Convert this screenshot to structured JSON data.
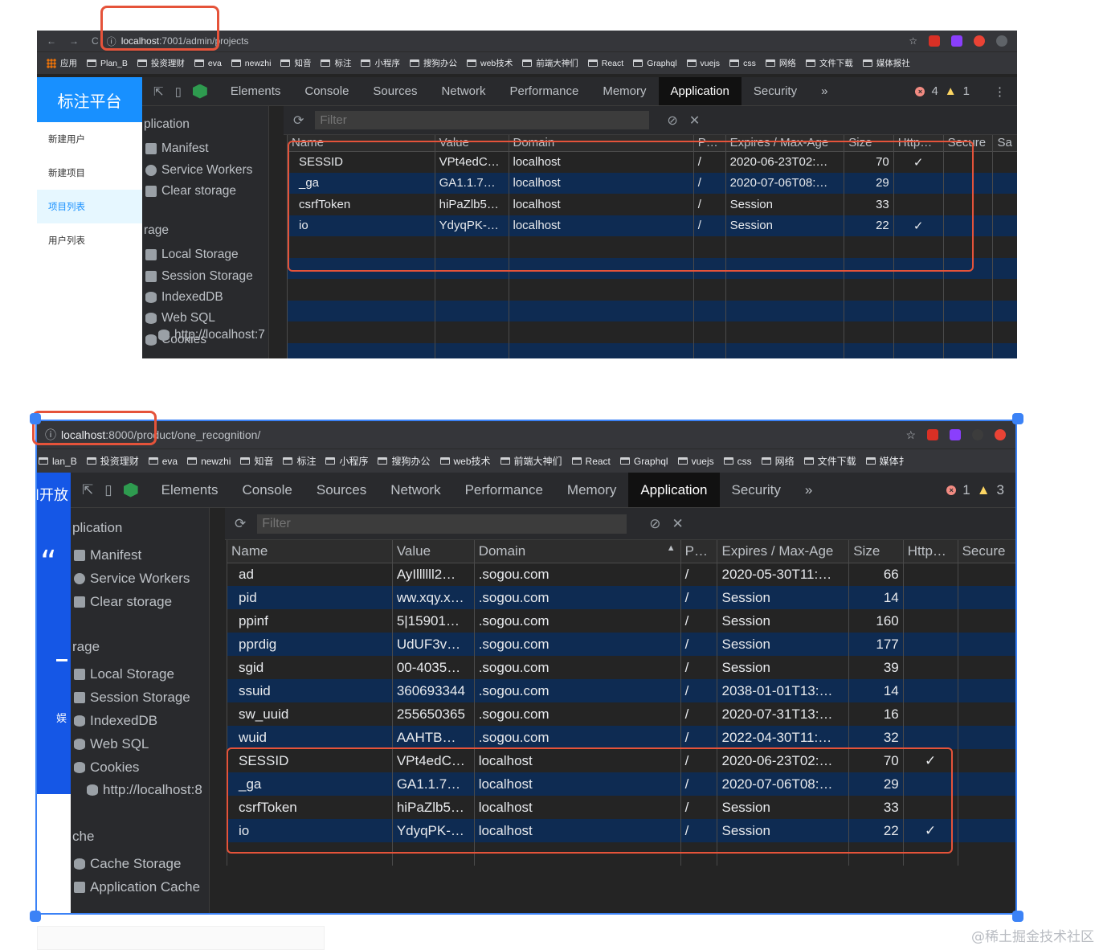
{
  "shot1": {
    "url_host": "localhost",
    "url_path": ":7001/admin/projects",
    "bookmarks": [
      "应用",
      "Plan_B",
      "投资理财",
      "eva",
      "newzhi",
      "知音",
      "标注",
      "小程序",
      "搜狗办公",
      "web技术",
      "前端大神们",
      "React",
      "Graphql",
      "vuejs",
      "css",
      "网络",
      "文件下载",
      "媒体报社"
    ],
    "app_title": "标注平台",
    "menu": [
      {
        "label": "新建用户",
        "active": false
      },
      {
        "label": "新建项目",
        "active": false
      },
      {
        "label": "项目列表",
        "active": true
      },
      {
        "label": "用户列表",
        "active": false
      }
    ],
    "tabs": [
      "Elements",
      "Console",
      "Sources",
      "Network",
      "Performance",
      "Memory",
      "Application",
      "Security"
    ],
    "active_tab": "Application",
    "more_tabs": "»",
    "error_count": "4",
    "warning_count": "1",
    "sidebar": {
      "section1": "plication",
      "section1_items": [
        "Manifest",
        "Service Workers",
        "Clear storage"
      ],
      "section2": "rage",
      "section2_items": [
        "Local Storage",
        "Session Storage",
        "IndexedDB",
        "Web SQL",
        "Cookies"
      ],
      "partial_item": "http://localhost:7"
    },
    "filter_placeholder": "Filter",
    "columns": [
      "Name",
      "Value",
      "Domain",
      "P…",
      "Expires / Max-Age",
      "Size",
      "Http…",
      "Secure",
      "Sa"
    ],
    "rows": [
      {
        "name": "SESSID",
        "value": "VPt4edC…",
        "domain": "localhost",
        "path": "/",
        "expires": "2020-06-23T02:…",
        "size": "70",
        "http": "✓",
        "secure": ""
      },
      {
        "name": "_ga",
        "value": "GA1.1.7…",
        "domain": "localhost",
        "path": "/",
        "expires": "2020-07-06T08:…",
        "size": "29",
        "http": "",
        "secure": ""
      },
      {
        "name": "csrfToken",
        "value": "hiPaZlb5…",
        "domain": "localhost",
        "path": "/",
        "expires": "Session",
        "size": "33",
        "http": "",
        "secure": ""
      },
      {
        "name": "io",
        "value": "YdyqPK-…",
        "domain": "localhost",
        "path": "/",
        "expires": "Session",
        "size": "22",
        "http": "✓",
        "secure": ""
      }
    ]
  },
  "shot2": {
    "url_host": "localhost",
    "url_path": ":8000/product/one_recognition/",
    "bookmarks": [
      "lan_B",
      "投资理财",
      "eva",
      "newzhi",
      "知音",
      "标注",
      "小程序",
      "搜狗办公",
      "web技术",
      "前端大神们",
      "React",
      "Graphql",
      "vuejs",
      "css",
      "网络",
      "文件下载",
      "媒体扌"
    ],
    "page_fragment_title": "l开放",
    "page_fragment_quote": "“",
    "page_fragment_char": "娱",
    "tabs": [
      "Elements",
      "Console",
      "Sources",
      "Network",
      "Performance",
      "Memory",
      "Application",
      "Security"
    ],
    "active_tab": "Application",
    "more_tabs": "»",
    "error_count": "1",
    "warning_count": "3",
    "sidebar": {
      "section1": "plication",
      "section1_items": [
        "Manifest",
        "Service Workers",
        "Clear storage"
      ],
      "section2": "rage",
      "section2_items": [
        "Local Storage",
        "Session Storage",
        "IndexedDB",
        "Web SQL",
        "Cookies"
      ],
      "cookie_child": "http://localhost:8",
      "section3": "che",
      "section3_items": [
        "Cache Storage",
        "Application Cache"
      ]
    },
    "filter_placeholder": "Filter",
    "columns": [
      "Name",
      "Value",
      "Domain",
      "P…",
      "Expires / Max-Age",
      "Size",
      "Http…",
      "Secure"
    ],
    "sort_indicator": "▲",
    "rows": [
      {
        "name": "ad",
        "value": "AyIllllll2…",
        "domain": ".sogou.com",
        "path": "/",
        "expires": "2020-05-30T11:…",
        "size": "66",
        "http": "",
        "secure": ""
      },
      {
        "name": "pid",
        "value": "ww.xqy.x…",
        "domain": ".sogou.com",
        "path": "/",
        "expires": "Session",
        "size": "14",
        "http": "",
        "secure": ""
      },
      {
        "name": "ppinf",
        "value": "5|15901…",
        "domain": ".sogou.com",
        "path": "/",
        "expires": "Session",
        "size": "160",
        "http": "",
        "secure": ""
      },
      {
        "name": "pprdig",
        "value": "UdUF3v…",
        "domain": ".sogou.com",
        "path": "/",
        "expires": "Session",
        "size": "177",
        "http": "",
        "secure": ""
      },
      {
        "name": "sgid",
        "value": "00-4035…",
        "domain": ".sogou.com",
        "path": "/",
        "expires": "Session",
        "size": "39",
        "http": "",
        "secure": ""
      },
      {
        "name": "ssuid",
        "value": "360693344",
        "domain": ".sogou.com",
        "path": "/",
        "expires": "2038-01-01T13:…",
        "size": "14",
        "http": "",
        "secure": ""
      },
      {
        "name": "sw_uuid",
        "value": "255650365",
        "domain": ".sogou.com",
        "path": "/",
        "expires": "2020-07-31T13:…",
        "size": "16",
        "http": "",
        "secure": ""
      },
      {
        "name": "wuid",
        "value": "AAHTB…",
        "domain": ".sogou.com",
        "path": "/",
        "expires": "2022-04-30T11:…",
        "size": "32",
        "http": "",
        "secure": ""
      },
      {
        "name": "SESSID",
        "value": "VPt4edC…",
        "domain": "localhost",
        "path": "/",
        "expires": "2020-06-23T02:…",
        "size": "70",
        "http": "✓",
        "secure": ""
      },
      {
        "name": "_ga",
        "value": "GA1.1.7…",
        "domain": "localhost",
        "path": "/",
        "expires": "2020-07-06T08:…",
        "size": "29",
        "http": "",
        "secure": ""
      },
      {
        "name": "csrfToken",
        "value": "hiPaZlb5…",
        "domain": "localhost",
        "path": "/",
        "expires": "Session",
        "size": "33",
        "http": "",
        "secure": ""
      },
      {
        "name": "io",
        "value": "YdyqPK-…",
        "domain": "localhost",
        "path": "/",
        "expires": "Session",
        "size": "22",
        "http": "✓",
        "secure": ""
      }
    ]
  },
  "watermark": "@稀土掘金技术社区",
  "colors": {
    "highlight_box": "#e5533a",
    "selection_border": "#3b82f6",
    "brand_blue": "#1890ff",
    "row_alt": "#0e2b52"
  },
  "icons": [
    "back-icon",
    "forward-icon",
    "reload-icon",
    "info-icon",
    "star-icon",
    "folder-icon",
    "inspect-icon",
    "device-icon",
    "vue-devtools-icon",
    "refresh-icon",
    "clear-icon",
    "close-icon",
    "gear-icon",
    "trash-icon",
    "database-icon",
    "cookie-icon",
    "grid-icon"
  ]
}
